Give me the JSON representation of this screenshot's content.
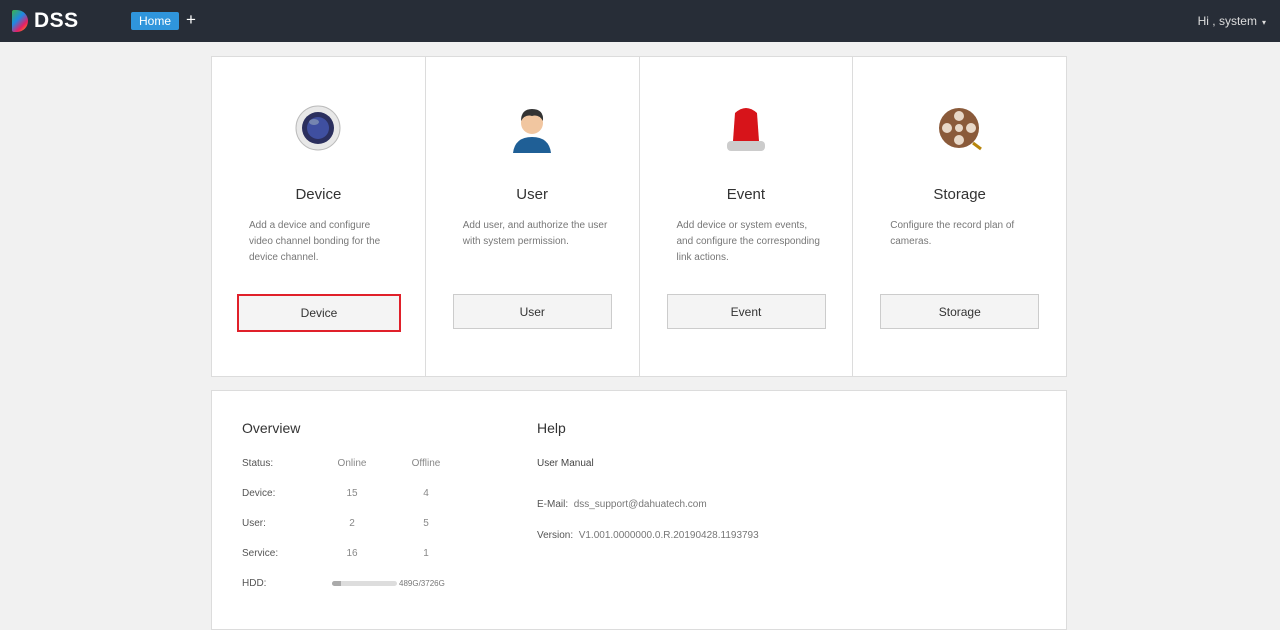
{
  "header": {
    "logo": "DSS",
    "tabs": [
      {
        "label": "Home"
      }
    ],
    "add_tab": "+",
    "user": "Hi , system",
    "caret": "▾"
  },
  "cards": [
    {
      "title": "Device",
      "desc": "Add a device and configure video channel bonding for the device channel.",
      "button": "Device",
      "icon": "camera-icon"
    },
    {
      "title": "User",
      "desc": "Add user, and authorize the user with system permission.",
      "button": "User",
      "icon": "user-icon"
    },
    {
      "title": "Event",
      "desc": "Add device or system events, and configure the corresponding link actions.",
      "button": "Event",
      "icon": "alarm-light-icon"
    },
    {
      "title": "Storage",
      "desc": "Configure the record plan of cameras.",
      "button": "Storage",
      "icon": "film-reel-icon"
    }
  ],
  "overview": {
    "title": "Overview",
    "status_label": "Status:",
    "online": "Online",
    "offline": "Offline",
    "rows": [
      {
        "label": "Device:",
        "online": "15",
        "offline": "4"
      },
      {
        "label": "User:",
        "online": "2",
        "offline": "5"
      },
      {
        "label": "Service:",
        "online": "16",
        "offline": "1"
      }
    ],
    "hdd_label": "HDD:",
    "hdd_text": "489G/3726G",
    "hdd_used_fraction": 0.131
  },
  "help": {
    "title": "Help",
    "manual": "User Manual",
    "email_label": "E-Mail:",
    "email": "dss_support@dahuatech.com",
    "version_label": "Version:",
    "version": "V1.001.0000000.0.R.20190428.1193793"
  },
  "colors": {
    "header": "#272d37",
    "accent": "#2f95dc",
    "selected_border": "#e0202a"
  }
}
